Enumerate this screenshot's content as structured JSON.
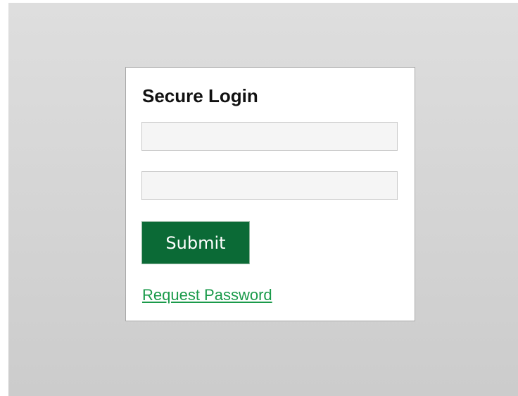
{
  "login": {
    "title": "Secure Login",
    "username_value": "",
    "username_placeholder": "",
    "password_value": "",
    "password_placeholder": "",
    "submit_label": "Submit",
    "request_password_label": "Request Password"
  },
  "colors": {
    "accent_green": "#0b6a36",
    "link_green": "#1a9a4a",
    "card_border": "#a8a8a8",
    "background_gray": "#d6d6d6"
  }
}
